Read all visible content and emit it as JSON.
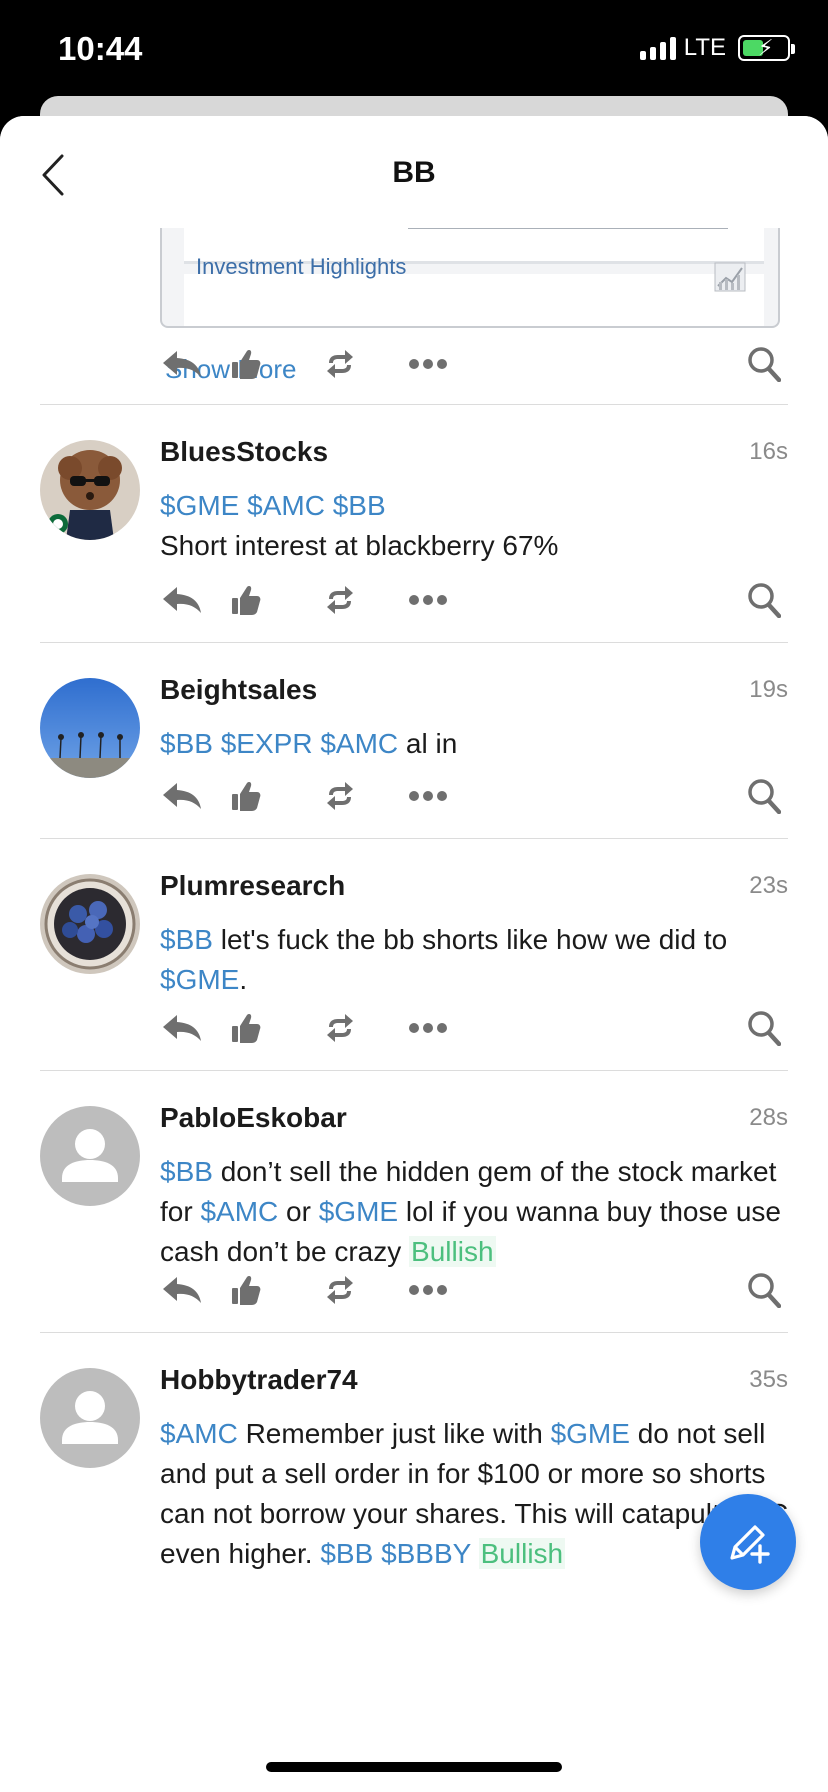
{
  "status": {
    "time": "10:44",
    "network": "LTE"
  },
  "nav": {
    "title": "BB"
  },
  "embed": {
    "heading": "Investment Highlights"
  },
  "show_more": "Show More",
  "posts": [
    {
      "username": "BluesStocks",
      "time": "16s",
      "avatar": "avatar-dog-sunglasses",
      "body": [
        {
          "t": "$GME",
          "k": "tk"
        },
        {
          "t": " "
        },
        {
          "t": "$AMC",
          "k": "tk"
        },
        {
          "t": " "
        },
        {
          "t": "$BB",
          "k": "tk"
        },
        {
          "t": "\n"
        },
        {
          "t": "Short interest at blackberry 67%"
        }
      ]
    },
    {
      "username": "Beightsales",
      "time": "19s",
      "avatar": "avatar-sky-palms",
      "body": [
        {
          "t": "$BB",
          "k": "tk"
        },
        {
          "t": " "
        },
        {
          "t": "$EXPR",
          "k": "tk"
        },
        {
          "t": " "
        },
        {
          "t": "$AMC",
          "k": "tk"
        },
        {
          "t": " al in"
        }
      ]
    },
    {
      "username": "Plumresearch",
      "time": "23s",
      "avatar": "avatar-plums-bowl",
      "body": [
        {
          "t": "$BB",
          "k": "tk"
        },
        {
          "t": " let's fuck the bb shorts like how we did to "
        },
        {
          "t": "$GME",
          "k": "tk"
        },
        {
          "t": "."
        }
      ]
    },
    {
      "username": "PabloEskobar",
      "time": "28s",
      "avatar": "avatar-default-person",
      "body": [
        {
          "t": "$BB",
          "k": "tk"
        },
        {
          "t": " don’t sell the hidden gem of the stock market for "
        },
        {
          "t": "$AMC",
          "k": "tk"
        },
        {
          "t": " or "
        },
        {
          "t": "$GME",
          "k": "tk"
        },
        {
          "t": " lol if you wanna buy those use cash don’t be crazy "
        },
        {
          "t": "Bullish",
          "k": "bull"
        }
      ]
    },
    {
      "username": "Hobbytrader74",
      "time": "35s",
      "avatar": "avatar-default-person",
      "body": [
        {
          "t": "$AMC",
          "k": "tk"
        },
        {
          "t": " Remember just like with "
        },
        {
          "t": "$GME",
          "k": "tk"
        },
        {
          "t": " do not sell and put a sell order in for $100 or more so shorts can not borrow your shares. This will catapult AMC even higher. "
        },
        {
          "t": "$BB",
          "k": "tk"
        },
        {
          "t": " "
        },
        {
          "t": "$BBBY",
          "k": "tk"
        },
        {
          "t": " "
        },
        {
          "t": "Bullish",
          "k": "bull"
        }
      ]
    }
  ],
  "icons": {
    "reply": "reply-icon",
    "like": "like-icon",
    "reshare": "reshare-icon",
    "more": "more-icon",
    "search": "search-icon",
    "compose": "compose-icon"
  },
  "colors": {
    "ticker": "#3d86c6",
    "bullish": "#4cbf7e",
    "fab": "#2f7fe8"
  }
}
